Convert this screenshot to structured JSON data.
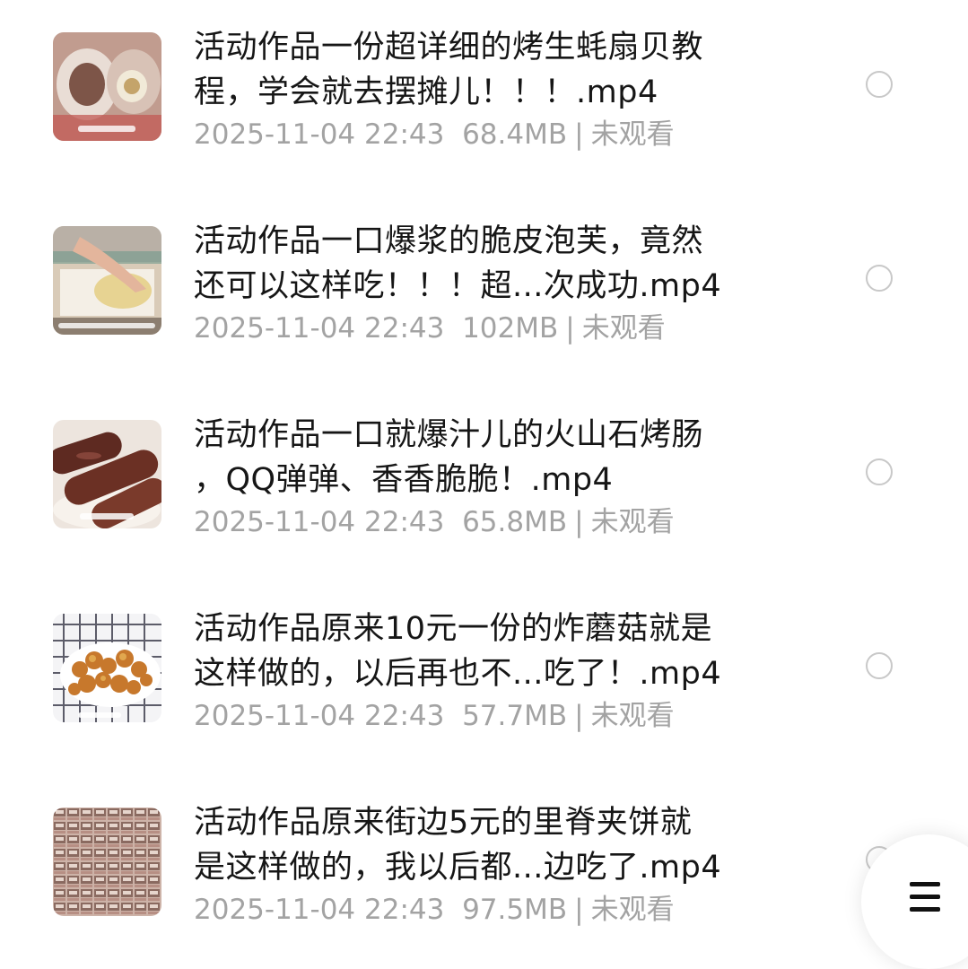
{
  "items": [
    {
      "title": "活动作品一份超详细的烤生蚝扇贝教\n程，学会就去摆摊儿！！！.mp4",
      "date": "2025-11-04 22:43",
      "size": "68.4MB",
      "status": "未观看",
      "thumb_icon": "scallop-thumbnail"
    },
    {
      "title": "活动作品一口爆浆的脆皮泡芙，竟然\n还可以这样吃！！！超...次成功.mp4",
      "date": "2025-11-04 22:43",
      "size": "102MB",
      "status": "未观看",
      "thumb_icon": "puff-dough-thumbnail"
    },
    {
      "title": "活动作品一口就爆汁儿的火山石烤肠\n，QQ弹弹、香香脆脆！.mp4",
      "date": "2025-11-04 22:43",
      "size": "65.8MB",
      "status": "未观看",
      "thumb_icon": "sausage-thumbnail"
    },
    {
      "title": "活动作品原来10元一份的炸蘑菇就是\n这样做的，以后再也不...吃了！.mp4",
      "date": "2025-11-04 22:43",
      "size": "57.7MB",
      "status": "未观看",
      "thumb_icon": "fried-mushroom-thumbnail"
    },
    {
      "title": "活动作品原来街边5元的里脊夹饼就\n是这样做的，我以后都...边吃了.mp4",
      "date": "2025-11-04 22:43",
      "size": "97.5MB",
      "status": "未观看",
      "thumb_icon": "pancake-grid-thumbnail"
    }
  ],
  "separator": "|",
  "fab_icon": "menu-icon"
}
